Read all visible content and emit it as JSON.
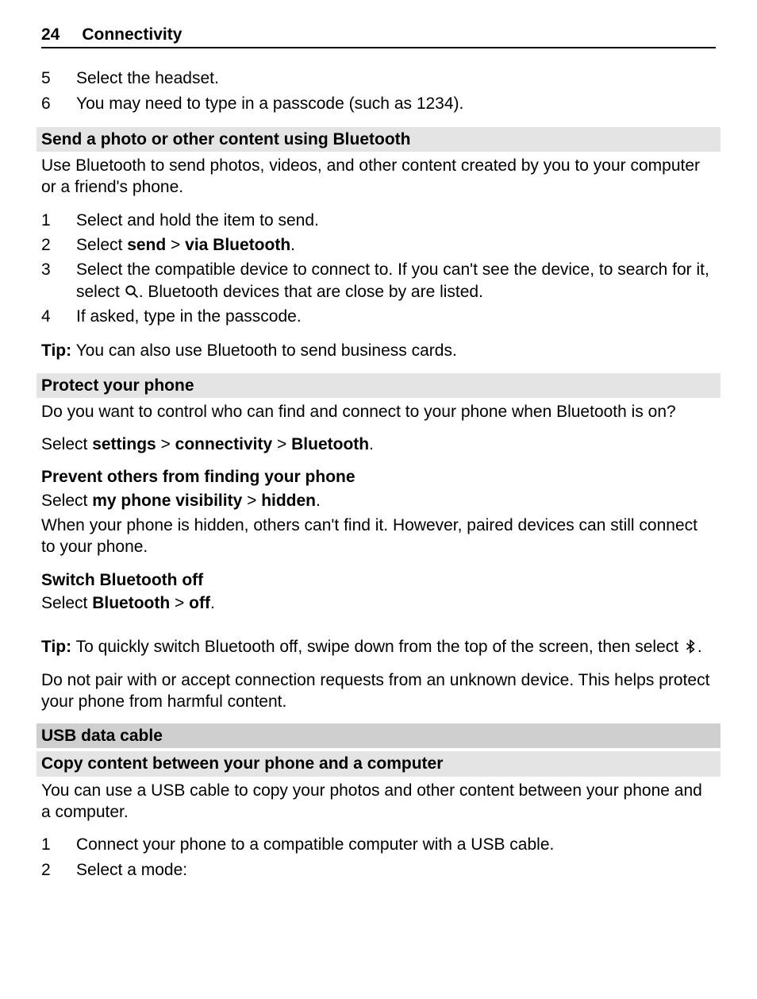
{
  "header": {
    "page_number": "24",
    "section": "Connectivity"
  },
  "top_list": {
    "items": [
      {
        "num": "5",
        "text": "Select the headset."
      },
      {
        "num": "6",
        "text": "You may need to type in a passcode (such as 1234)."
      }
    ]
  },
  "send_photo": {
    "heading": "Send a photo or other content using Bluetooth",
    "intro": "Use Bluetooth to send photos, videos, and other content created by you to your computer or a friend's phone.",
    "steps": {
      "i1_num": "1",
      "i1_text": "Select and hold the item to send.",
      "i2_num": "2",
      "i2_pre": "Select ",
      "i2_b1": "send",
      "i2_sep": " > ",
      "i2_b2": "via Bluetooth",
      "i2_post": ".",
      "i3_num": "3",
      "i3_a": "Select the compatible device to connect to. If you can't see the device, to search for it, select ",
      "i3_b": ". Bluetooth devices that are close by are listed.",
      "i4_num": "4",
      "i4_text": "If asked, type in the passcode."
    },
    "tip_label": "Tip:",
    "tip_text": " You can also use Bluetooth to send business cards."
  },
  "protect": {
    "heading": "Protect your phone",
    "intro": "Do you want to control who can find and connect to your phone when Bluetooth is on?",
    "select_pre": "Select ",
    "select_b1": "settings",
    "sep": " > ",
    "select_b2": "connectivity",
    "select_b3": "Bluetooth",
    "select_post": ".",
    "prevent_heading": "Prevent others from finding your phone",
    "prevent_pre": "Select ",
    "prevent_b1": "my phone visibility",
    "prevent_b2": "hidden",
    "prevent_post": ".",
    "prevent_note": "When your phone is hidden, others can't find it. However, paired devices can still connect to your phone.",
    "switch_heading": "Switch Bluetooth off",
    "switch_pre": "Select ",
    "switch_b1": "Bluetooth",
    "switch_b2": "off",
    "switch_post": ".",
    "tip2_label": "Tip:",
    "tip2_a": " To quickly switch Bluetooth off, swipe down from the top of the screen, then select ",
    "tip2_b": ".",
    "warn": "Do not pair with or accept connection requests from an unknown device. This helps protect your phone from harmful content."
  },
  "usb": {
    "heading": "USB data cable",
    "sub_heading": "Copy content between your phone and a computer",
    "intro": "You can use a USB cable to copy your photos and other content between your phone and a computer.",
    "steps": [
      {
        "num": "1",
        "text": "Connect your phone to a compatible computer with a USB cable."
      },
      {
        "num": "2",
        "text": "Select a mode:"
      }
    ]
  }
}
